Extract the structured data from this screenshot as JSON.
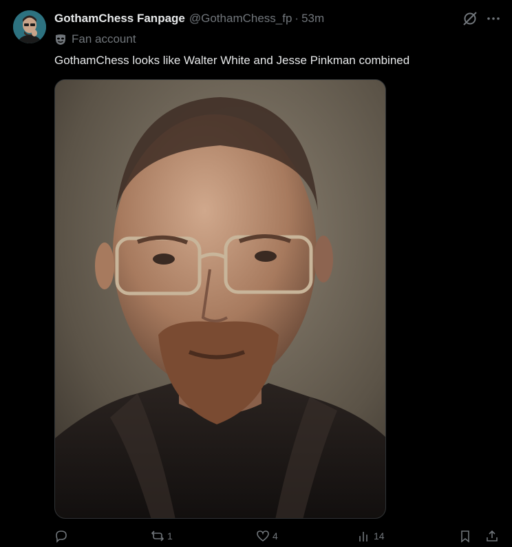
{
  "author": {
    "display_name": "GothamChess Fanpage",
    "handle": "@GothamChess_fp",
    "separator": "·",
    "time": "53m",
    "affiliation_label": "Fan account",
    "affiliation_icon": "mask-icon"
  },
  "tweet": {
    "text": "GothamChess looks like Walter White and Jesse Pinkman combined"
  },
  "media": {
    "icon": "image-icon"
  },
  "actions": {
    "reply_count": "",
    "repost_count": "1",
    "like_count": "4",
    "views_count": "14"
  },
  "colors": {
    "background": "#000000",
    "primary_text": "#e7e9ea",
    "secondary_text": "#71767b",
    "border": "#2f3336"
  }
}
